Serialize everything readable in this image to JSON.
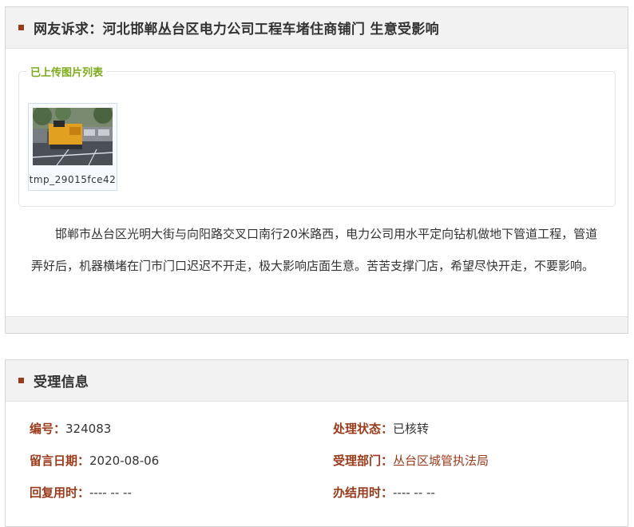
{
  "complaint": {
    "header_title": "网友诉求：河北邯郸丛台区电力公司工程车堵住商铺门 生意受影响",
    "images_legend": "已上传图片列表",
    "images": [
      {
        "caption": "tmp_29015fce42"
      }
    ],
    "body": "邯郸市丛台区光明大街与向阳路交叉口南行20米路西，电力公司用水平定向钻机做地下管道工程，管道弄好后，机器横堵在门市门口迟迟不开走，极大影响店面生意。苦苦支撑门店，希望尽快开走，不要影响。"
  },
  "acceptance": {
    "header_title": "受理信息",
    "number_label": "编号：",
    "number_value": "324083",
    "status_label": "处理状态：",
    "status_value": "已核转",
    "date_label": "留言日期：",
    "date_value": "2020-08-06",
    "dept_label": "受理部门：",
    "dept_value": "丛台区城管执法局",
    "reply_time_label": "回复用时：",
    "reply_time_value": "---- -- --",
    "finish_time_label": "办结用时：",
    "finish_time_value": "---- -- --"
  },
  "colors": {
    "accent": "#9b3a1a",
    "legend_green": "#7bab19",
    "header_bg": "#f2f2f2"
  }
}
